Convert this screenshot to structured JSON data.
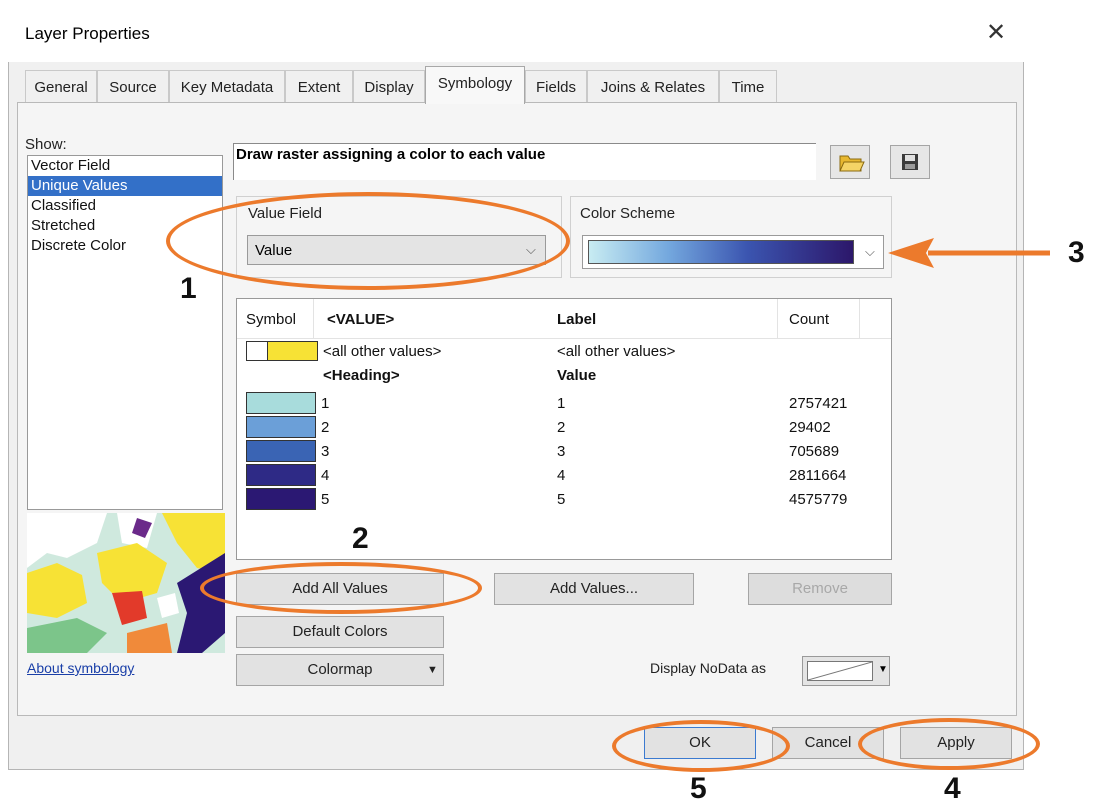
{
  "window": {
    "title": "Layer Properties",
    "close_symbol": "✕"
  },
  "tabs": [
    {
      "label": "General"
    },
    {
      "label": "Source"
    },
    {
      "label": "Key Metadata"
    },
    {
      "label": "Extent"
    },
    {
      "label": "Display"
    },
    {
      "label": "Symbology"
    },
    {
      "label": "Fields"
    },
    {
      "label": "Joins & Relates"
    },
    {
      "label": "Time"
    }
  ],
  "active_tab": "Symbology",
  "show": {
    "label": "Show:",
    "items": [
      "Vector Field",
      "Unique Values",
      "Classified",
      "Stretched",
      "Discrete Color"
    ],
    "selected": "Unique Values"
  },
  "description": "Draw raster assigning a color to each value",
  "value_field": {
    "label": "Value Field",
    "value": "Value"
  },
  "color_scheme": {
    "label": "Color Scheme",
    "colors": [
      "#bfe7f0",
      "#5b8fd0",
      "#2c3a90",
      "#2c176a"
    ]
  },
  "table": {
    "headers": {
      "symbol": "Symbol",
      "value": "<VALUE>",
      "label": "Label",
      "count": "Count"
    },
    "other": {
      "value": "<all other values>",
      "label": "<all other values>",
      "swatch_color": "#f7e235"
    },
    "heading": {
      "value": "<Heading>",
      "label": "Value"
    },
    "rows": [
      {
        "value": "1",
        "label": "1",
        "count": "2757421",
        "color": "#a8dcdc"
      },
      {
        "value": "2",
        "label": "2",
        "count": "29402",
        "color": "#6b9fd8"
      },
      {
        "value": "3",
        "label": "3",
        "count": "705689",
        "color": "#3a64b4"
      },
      {
        "value": "4",
        "label": "4",
        "count": "2811664",
        "color": "#2e2a86"
      },
      {
        "value": "5",
        "label": "5",
        "count": "4575779",
        "color": "#2b1873"
      }
    ]
  },
  "buttons": {
    "add_all": "Add All Values",
    "add_values": "Add Values...",
    "remove": "Remove",
    "default_colors": "Default Colors",
    "colormap": "Colormap",
    "ok": "OK",
    "cancel": "Cancel",
    "apply": "Apply"
  },
  "about_link": "About symbology",
  "nodata_label": "Display NoData as",
  "annotations": [
    "1",
    "2",
    "3",
    "4",
    "5"
  ],
  "accent": "#ec7a2c"
}
